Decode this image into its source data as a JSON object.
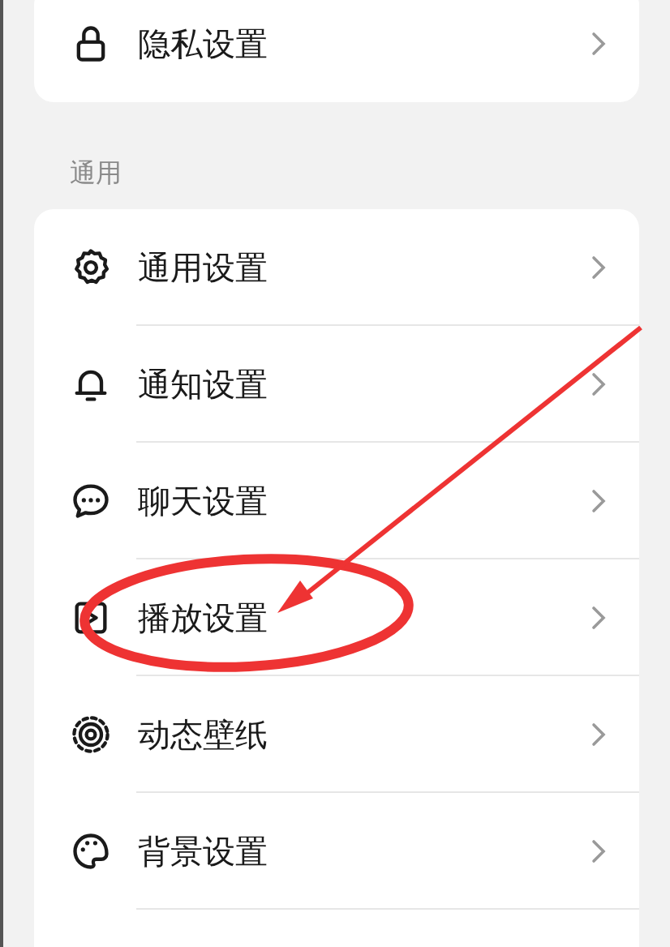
{
  "sections": [
    {
      "items": [
        {
          "label": "隐私设置",
          "highlighted": false
        }
      ]
    },
    {
      "header": "通用",
      "items": [
        {
          "label": "通用设置",
          "highlighted": false
        },
        {
          "label": "通知设置",
          "highlighted": false
        },
        {
          "label": "聊天设置",
          "highlighted": false
        },
        {
          "label": "播放设置",
          "highlighted": true
        },
        {
          "label": "动态壁纸",
          "highlighted": false
        },
        {
          "label": "背景设置",
          "highlighted": false
        }
      ]
    }
  ]
}
